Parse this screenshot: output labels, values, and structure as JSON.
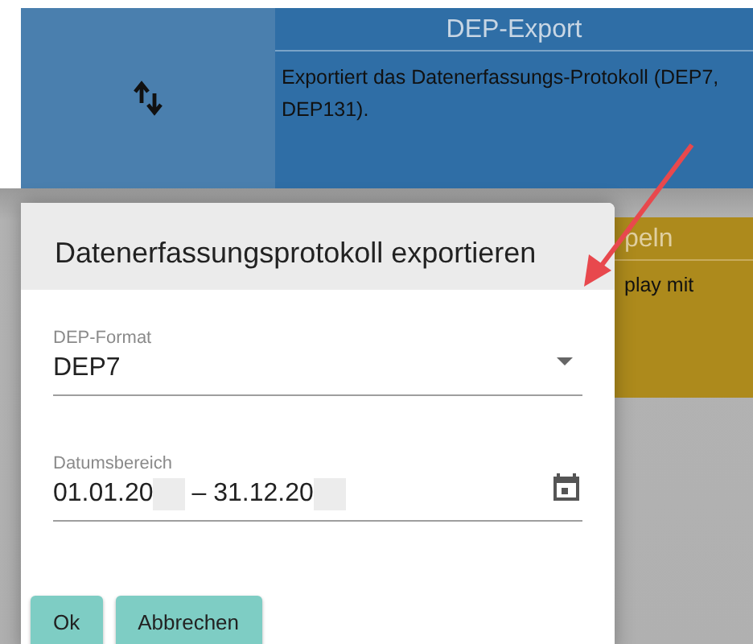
{
  "tiles": [
    {
      "kind": "icon",
      "title": "DEP-Export",
      "description": "Exportiert das Datenerfassungs-Protokoll (DEP7, DEP131)."
    },
    {
      "title": "peln",
      "description": "play mit"
    }
  ],
  "dialog": {
    "title": "Datenerfassungsprotokoll exportieren",
    "fields": [
      {
        "kind": "select",
        "label": "DEP-Format",
        "value": "DEP7"
      },
      {
        "kind": "daterange",
        "label": "Datumsbereich",
        "start": "01.01.20",
        "end": "– 31.12.20"
      }
    ],
    "buttons": [
      "Ok",
      "Abbrechen"
    ]
  }
}
